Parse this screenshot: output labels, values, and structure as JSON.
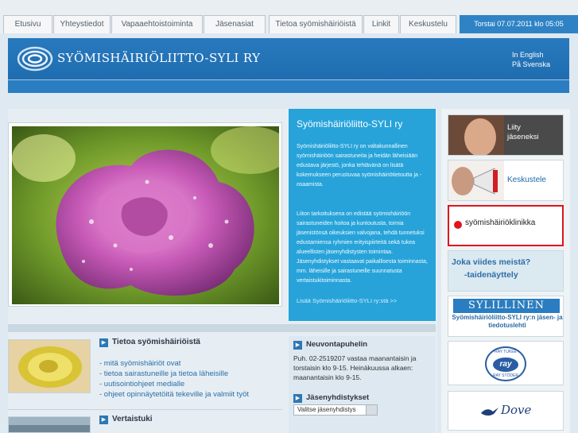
{
  "nav": {
    "tabs": [
      "Etusivu",
      "Yhteystiedot",
      "Vapaaehtoistoiminta",
      "Jäsenasiat",
      "Tietoa syömishäiriöistä",
      "Linkit",
      "Keskustelu"
    ],
    "datetime": "Torstai 07.07.2011 klo 05:05"
  },
  "header": {
    "logo_text": "SYÖMISHÄIRIÖLIITTO-SYLI RY",
    "lang_en": "In English",
    "lang_sv": "På Svenska"
  },
  "intro": {
    "title": "Syömishäiriöliitto-SYLI ry",
    "p1": "Syömishäiriöliitto-SYLI ry on valtakunnallinen syömishäiriöön sairastuneita ja heidän läheisiään edustava järjestö, jonka tehtävänä on lisätä kokemukseen perustuvaa syömishäiriötietoutta ja -osaamista.",
    "p2": "Liiton tarkoituksena on edistää syömishäiriöön sairastuneiden hoitoa ja kuntoutusta, toimia jäsenistönsä oikeuksien valvojana, tehdä tunnetuksi edustamiensa ryhmien erityispiirteitä sekä tukea alueellisten jäsenyhdistysten toimintaa. Jäsenyhdistykset vastaavat paikallisesta toiminnasta, mm. läheisille ja sairastuneille suunnatusta vertaistukitoiminnasta.",
    "more": "Lisää Syömishäiriöliitto-SYLI ry:stä >>"
  },
  "sections": {
    "info": {
      "title": "Tietoa syömishäiriöistä",
      "links": [
        "- mitä syömishäiriöt ovat",
        "- tietoa sairastuneille ja tietoa läheisille",
        "- uutisointiohjeet medialle",
        "- ohjeet opinnäytetöitä tekeville ja valmiit työt"
      ]
    },
    "peer": {
      "title": "Vertaistuki"
    }
  },
  "news": {
    "title": "Neuvontapuhelin",
    "body": "Puh. 02-2519207  vastaa maanantaisin ja torstaisin klo 9-15. Heinäkuussa alkaen: maanantaisin klo 9-15.",
    "member_title": "Jäsenyhdistykset",
    "select_value": "Valitse jäsenyhdistys"
  },
  "ads": {
    "join": "Liity\njäseneksi",
    "discuss": "Keskustele",
    "clinic": "syömishäiriöklinikka",
    "exhibition_l1": "Joka viides meistä?",
    "exhibition_l2": "-taidenäyttely",
    "sylillinen": "SYLILLINEN",
    "sylillinen_sub": "Syömishäiriöliitto-SYLI ry:n jäsen- ja tiedotuslehti",
    "raytuki_top": "RAY TUKEE",
    "raytuki_mid": "ray",
    "raytuki_bot": "RAY STÖDER",
    "dove": "Dove"
  },
  "colors": {
    "primary_blue": "#2879be",
    "intro_blue": "#27a3da",
    "clinic_red": "#e0141c"
  }
}
